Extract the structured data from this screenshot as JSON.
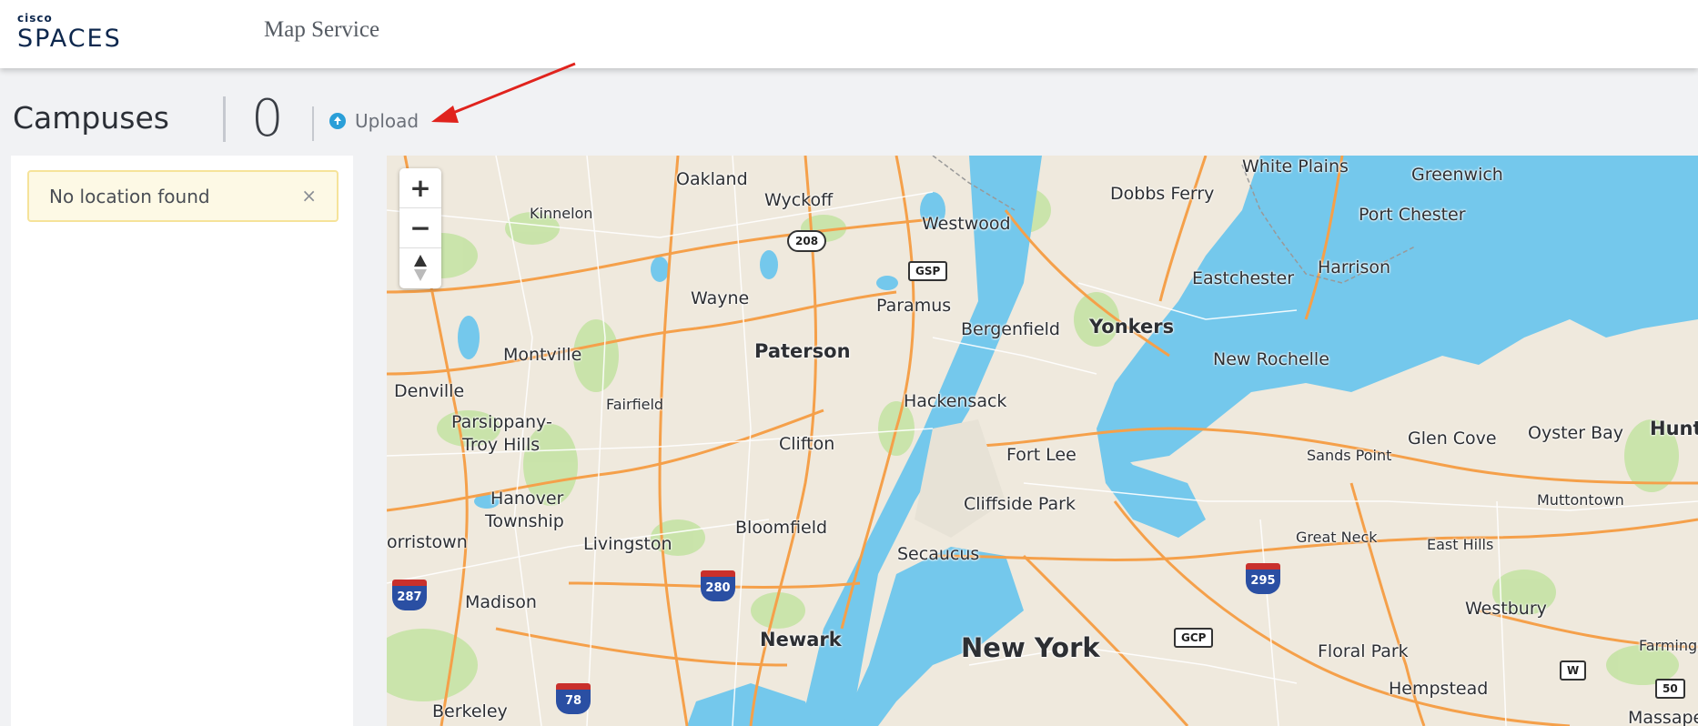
{
  "header": {
    "brand_top": "cisco",
    "brand_bottom": "SPACES",
    "title": "Map Service"
  },
  "subheader": {
    "campuses_label": "Campuses",
    "campus_count": "0",
    "upload_label": "Upload",
    "upload_icon": "upload-circle-icon"
  },
  "sidebar": {
    "alert_text": "No location found",
    "alert_close": "×"
  },
  "map": {
    "controls": {
      "zoom_in": "+",
      "zoom_out": "−",
      "compass_icon": "compass-icon"
    },
    "labels": {
      "oakland": "Oakland",
      "wyckoff": "Wyckoff",
      "kinnelon": "Kinnelon",
      "westwood": "Westwood",
      "dobbs_ferry": "Dobbs Ferry",
      "white_plains": "White Plains",
      "greenwich": "Greenwich",
      "port_chester": "Port Chester",
      "harrison": "Harrison",
      "eastchester": "Eastchester",
      "wayne": "Wayne",
      "paramus": "Paramus",
      "bergenfield": "Bergenfield",
      "yonkers": "Yonkers",
      "montville": "Montville",
      "paterson": "Paterson",
      "new_rochelle": "New Rochelle",
      "denville": "Denville",
      "hackensack": "Hackensack",
      "fairfield": "Fairfield",
      "parsippany": "Parsippany-",
      "troy_hills": "Troy Hills",
      "clifton": "Clifton",
      "fort_lee": "Fort Lee",
      "sands_point": "Sands Point",
      "glen_cove": "Glen Cove",
      "oyster_bay": "Oyster Bay",
      "hunti": "Hunti",
      "hanover": "Hanover",
      "township": "Township",
      "cliffside_park": "Cliffside Park",
      "muttontown": "Muttontown",
      "orristown": "orristown",
      "livingston": "Livingston",
      "bloomfield": "Bloomfield",
      "great_neck": "Great Neck",
      "east_hills": "East Hills",
      "secaucus": "Secaucus",
      "madison": "Madison",
      "westbury": "Westbury",
      "newark": "Newark",
      "new_york": "New York",
      "floral_park": "Floral Park",
      "farmingd": "Farmingd",
      "hempstead": "Hempstead",
      "berkeley": "Berkeley",
      "massapeq": "Massapeq"
    },
    "shields": {
      "r208": "208",
      "gsp": "GSP",
      "i287": "287",
      "i280": "280",
      "i295": "295",
      "gcp": "GCP",
      "i78": "78",
      "w": "W",
      "r50": "50"
    },
    "colors": {
      "land": "#efe9dd",
      "water": "#74c8ec",
      "park": "#c5e3a5",
      "highway": "#f5a04a",
      "minor_road": "#ffffff"
    }
  },
  "annotation": {
    "arrow_color": "#e0231d"
  }
}
